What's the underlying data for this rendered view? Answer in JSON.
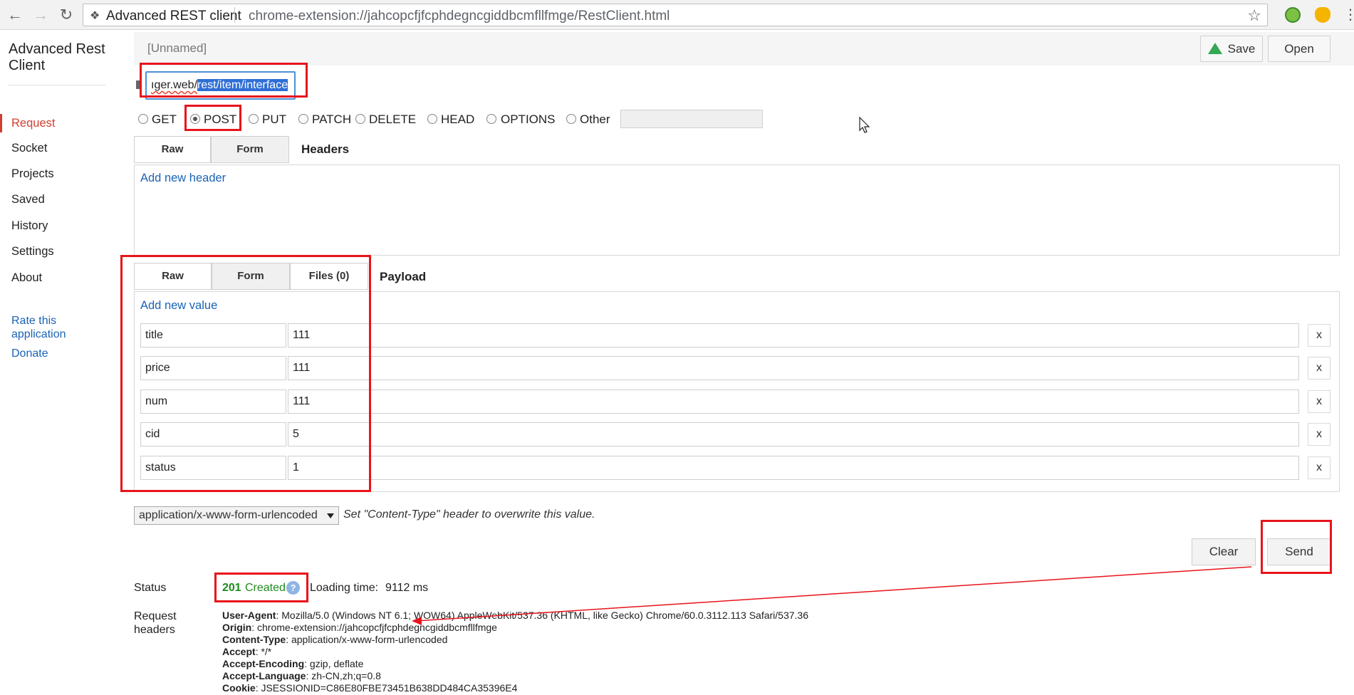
{
  "browser": {
    "tab_site": "Advanced REST client",
    "url": "chrome-extension://jahcopcfjfcphdegncgiddbcmfllfmge/RestClient.html"
  },
  "sidebar": {
    "app_title": "Advanced Rest Client",
    "items": [
      {
        "label": "Request",
        "active": true
      },
      {
        "label": "Socket"
      },
      {
        "label": "Projects"
      },
      {
        "label": "Saved"
      },
      {
        "label": "History"
      },
      {
        "label": "Settings"
      },
      {
        "label": "About"
      }
    ],
    "rate_link": "Rate this application",
    "donate_link": "Donate"
  },
  "toolbar": {
    "name": "[Unnamed]",
    "save_label": "Save",
    "open_label": "Open"
  },
  "request": {
    "url_plain": "ıger.web/",
    "url_selected": "rest/item/interface",
    "methods": [
      "GET",
      "POST",
      "PUT",
      "PATCH",
      "DELETE",
      "HEAD",
      "OPTIONS",
      "Other"
    ],
    "selected_method": "POST"
  },
  "headers": {
    "tabs": [
      "Raw",
      "Form"
    ],
    "active_tab": "Form",
    "title": "Headers",
    "add_link": "Add new header"
  },
  "payload": {
    "tabs": [
      "Raw",
      "Form",
      "Files (0)"
    ],
    "active_tab": "Form",
    "title": "Payload",
    "add_link": "Add new value",
    "rows": [
      {
        "key": "title",
        "value": "111"
      },
      {
        "key": "price",
        "value": "111"
      },
      {
        "key": "num",
        "value": "111"
      },
      {
        "key": "cid",
        "value": "5"
      },
      {
        "key": "status",
        "value": "1"
      }
    ],
    "remove_label": "x",
    "content_type": "application/x-www-form-urlencoded",
    "content_type_hint": "Set \"Content-Type\" header to overwrite this value."
  },
  "actions": {
    "clear_label": "Clear",
    "send_label": "Send"
  },
  "response": {
    "status_label": "Status",
    "status_code": "201",
    "status_text": "Created",
    "help_icon": "?",
    "loading_label": "Loading time:",
    "loading_value": "9112 ms",
    "request_headers_label": "Request headers",
    "request_headers": [
      {
        "name": "User-Agent",
        "value": "Mozilla/5.0 (Windows NT 6.1; WOW64) AppleWebKit/537.36 (KHTML, like Gecko) Chrome/60.0.3112.113 Safari/537.36"
      },
      {
        "name": "Origin",
        "value": "chrome-extension://jahcopcfjfcphdegncgiddbcmfllfmge"
      },
      {
        "name": "Content-Type",
        "value": "application/x-www-form-urlencoded"
      },
      {
        "name": "Accept",
        "value": "*/*"
      },
      {
        "name": "Accept-Encoding",
        "value": "gzip, deflate"
      },
      {
        "name": "Accept-Language",
        "value": "zh-CN,zh;q=0.8"
      },
      {
        "name": "Cookie",
        "value": "JSESSIONID=C86E80FBE73451B638DD484CA35396E4"
      }
    ]
  },
  "colors": {
    "accent_red": "#d23f31",
    "link_blue": "#1a63b5",
    "status_green": "#1e8a1e",
    "annotation_red": "#e8141b"
  },
  "icons": [
    "back-arrow-icon",
    "forward-arrow-icon",
    "reload-icon",
    "extension-icon",
    "star-icon",
    "google-drive-icon",
    "help-icon",
    "dropdown-arrow-icon"
  ]
}
